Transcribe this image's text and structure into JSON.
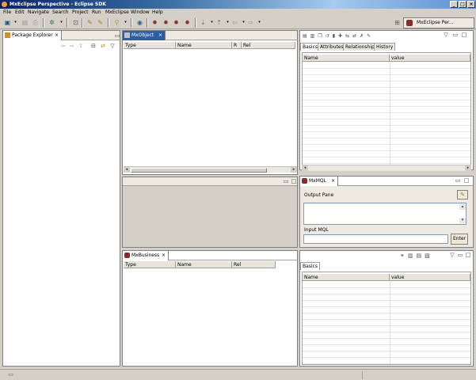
{
  "window": {
    "title": "MxEclipse Perspective - Eclipse SDK",
    "buttons": [
      "_",
      "□",
      "×"
    ]
  },
  "menu": [
    "File",
    "Edit",
    "Navigate",
    "Search",
    "Project",
    "Run",
    "MxEclipse",
    "Window",
    "Help"
  ],
  "perspective": {
    "label": "MxEclipse Per..."
  },
  "package_explorer": {
    "tab": "Package Explorer"
  },
  "mxobject": {
    "tab": "MxObject",
    "columns": [
      "Type",
      "Name",
      "R",
      "Rel"
    ]
  },
  "props_top": {
    "tabs": [
      "Basics",
      "Attributes",
      "Relationship",
      "History"
    ],
    "columns": [
      "Name",
      "value"
    ]
  },
  "mxmql": {
    "tab": "MxMQL",
    "output_label": "Output Pane",
    "input_label": "Input MQL",
    "input_value": "",
    "enter_label": "Enter"
  },
  "mxbusiness": {
    "tab": "MxBusiness",
    "columns": [
      "Type",
      "Name",
      "Rel"
    ]
  },
  "props_bottom": {
    "tabs": [
      "Basics"
    ],
    "columns": [
      "Name",
      "value"
    ]
  },
  "icons": {
    "close": "×",
    "minimize": "▭",
    "maximize": "□",
    "menu": "▽"
  },
  "colors": {
    "active_tab": "#2f5ea3",
    "chrome": "#d4d0c8"
  }
}
